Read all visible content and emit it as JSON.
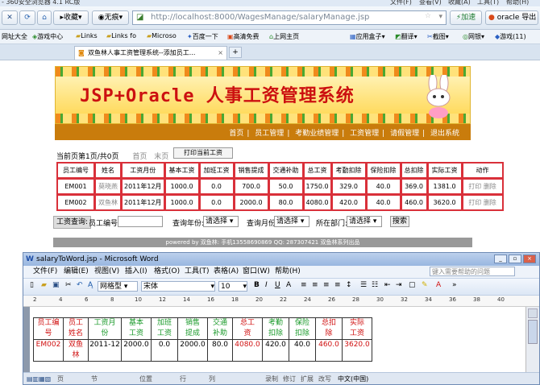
{
  "browser": {
    "title": "- 360安全浏览器 4.1 RC版",
    "menu": [
      "文件(F)",
      "查看(V)",
      "收藏(A)",
      "工具(T)",
      "帮助(H)"
    ],
    "back_label": "收藏",
    "noimg_label": "无痕",
    "url": "http://localhost:8000/WagesManage/salaryManage.jsp",
    "accelerate": "加速",
    "search_engine": "oracle 导出",
    "bookmarks": [
      "网址大全",
      "游戏中心",
      "Links",
      "Links fo",
      "Microso",
      "百度一下",
      "高清免费",
      "上网主页",
      "应用盒子",
      "翻译",
      "截图",
      "网银",
      "游戏(11)"
    ],
    "tab_title": "双鱼林人事工资管理系统--添加员工..."
  },
  "banner": {
    "title": "JSP+Oracle 人事工资管理系统"
  },
  "nav": [
    "首页",
    "员工管理",
    "考勤业绩管理",
    "工资管理",
    "请假管理",
    "退出系统"
  ],
  "pager": {
    "info": "当前页第1页/共0页",
    "first": "首页",
    "last": "末页",
    "print": "打印当前工资"
  },
  "table": {
    "headers": [
      "员工编号",
      "姓名",
      "工资月份",
      "基本工资",
      "加班工资",
      "销售提成",
      "交通补助",
      "总工资",
      "考勤扣除",
      "保险扣除",
      "总扣除",
      "实际工资",
      "动作"
    ],
    "rows": [
      {
        "id": "EM001",
        "name": "莫晓燕",
        "month": "2011年12月",
        "base": "1000.0",
        "overtime": "0.0",
        "sales": "700.0",
        "traffic": "50.0",
        "total": "1750.0",
        "attendance": "329.0",
        "insurance": "40.0",
        "deduct": "369.0",
        "actual": "1381.0",
        "act1": "打印",
        "act2": "删除"
      },
      {
        "id": "EM002",
        "name": "双鱼林",
        "month": "2011年12月",
        "base": "1000.0",
        "overtime": "0.0",
        "sales": "2000.0",
        "traffic": "80.0",
        "total": "4080.0",
        "attendance": "420.0",
        "insurance": "40.0",
        "deduct": "460.0",
        "actual": "3620.0",
        "act1": "打印",
        "act2": "删除"
      }
    ]
  },
  "query": {
    "label": "工资查询:",
    "emp_label": "员工编号:",
    "year_label": "查询年份:",
    "year_value": "请选择",
    "month_label": "查询月份:",
    "month_value": "请选择",
    "dept_label": "所在部门:",
    "dept_value": "请选择",
    "search": "搜索"
  },
  "footer": "powered by 双鱼林: 手机13558690869 QQ: 287307421 双鱼林系列出品",
  "word": {
    "title": "salaryToWord.jsp - Microsoft Word",
    "menu": [
      "文件(F)",
      "编辑(E)",
      "视图(V)",
      "插入(I)",
      "格式(O)",
      "工具(T)",
      "表格(A)",
      "窗口(W)",
      "帮助(H)"
    ],
    "help_placeholder": "键入需要帮助的问题",
    "style": "网格型",
    "font": "宋体",
    "size": "10",
    "ruler": [
      "2",
      "4",
      "6",
      "8",
      "10",
      "12",
      "14",
      "16",
      "18",
      "20",
      "22",
      "24",
      "26",
      "28",
      "30",
      "32",
      "34",
      "36",
      "38",
      "40"
    ],
    "headers": [
      [
        "员工编",
        "号"
      ],
      [
        "员工",
        "姓名"
      ],
      [
        "工资月",
        "份"
      ],
      [
        "基本",
        "工资"
      ],
      [
        "加班",
        "工资"
      ],
      [
        "销售",
        "提成"
      ],
      [
        "交通",
        "补助"
      ],
      [
        "总工",
        "资"
      ],
      [
        "考勤",
        "扣除"
      ],
      [
        "保险",
        "扣除"
      ],
      [
        "总扣",
        "除"
      ],
      [
        "实际",
        "工资"
      ]
    ],
    "row": [
      [
        "EM002"
      ],
      [
        "双鱼",
        "林"
      ],
      [
        "2011-12"
      ],
      [
        "2000.0"
      ],
      [
        "0.0"
      ],
      [
        "2000.0"
      ],
      [
        "80.0"
      ],
      [
        "4080.0"
      ],
      [
        "420.0"
      ],
      [
        "40.0"
      ],
      [
        "460.0"
      ],
      [
        "3620.0"
      ]
    ],
    "status": [
      "页",
      "节",
      "位置",
      "行",
      "列",
      "录制",
      "修订",
      "扩展",
      "改写",
      "中文(中国)"
    ]
  }
}
